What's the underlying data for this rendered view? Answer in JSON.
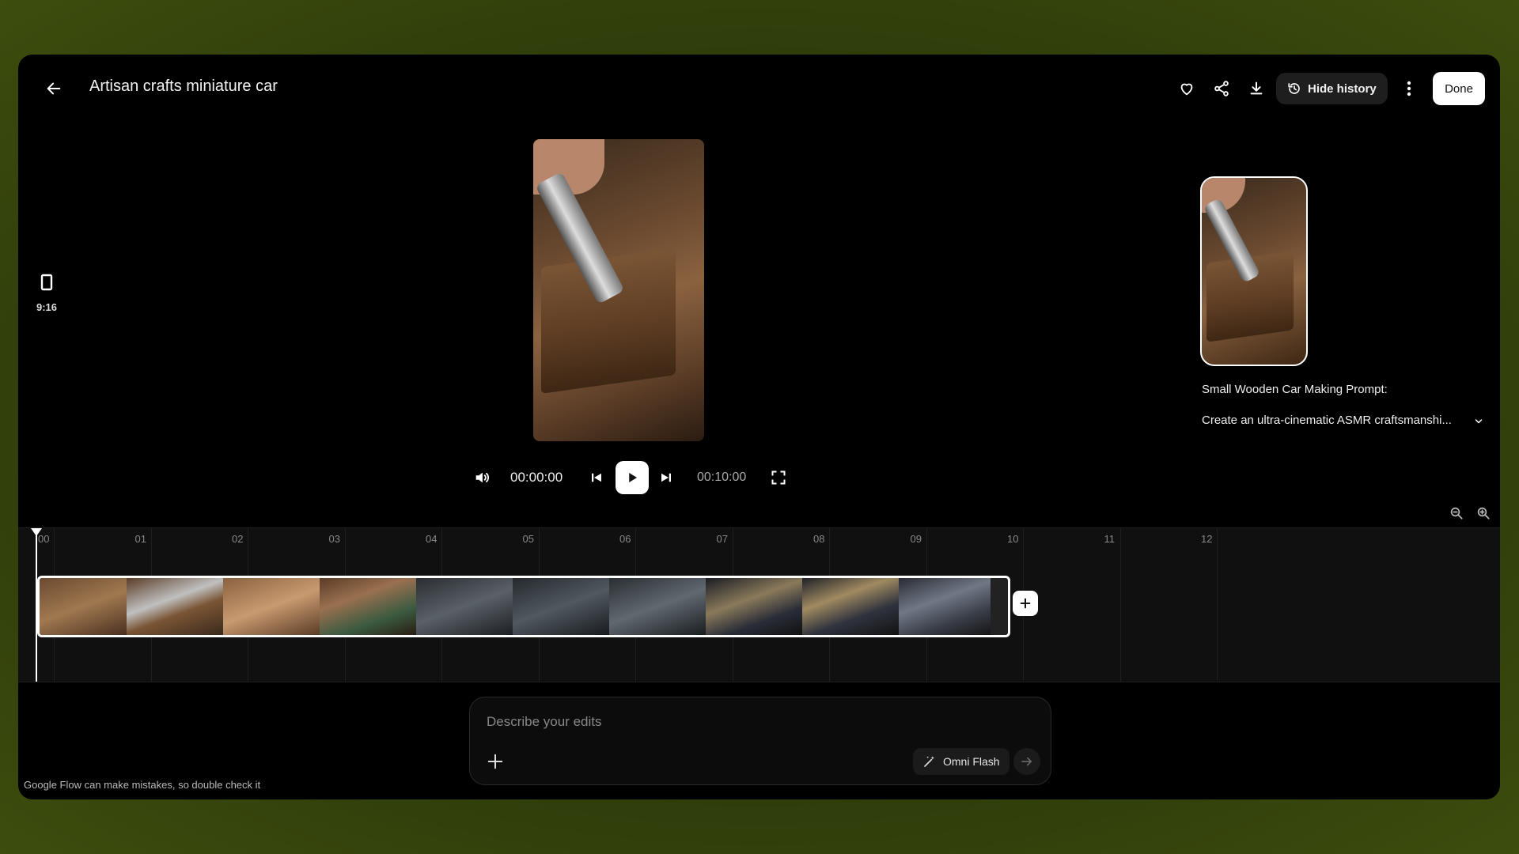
{
  "header": {
    "title": "Artisan crafts miniature car",
    "hide_history_label": "Hide history",
    "done_label": "Done"
  },
  "aspect": {
    "label": "9:16"
  },
  "history": {
    "prompt_title": "Small Wooden Car Making Prompt:",
    "prompt_text": "Create an ultra-cinematic ASMR craftsmanshi..."
  },
  "player": {
    "current_time": "00:00:00",
    "total_time": "00:10:00"
  },
  "timeline": {
    "ticks": [
      "00",
      "01",
      "02",
      "03",
      "04",
      "05",
      "06",
      "07",
      "08",
      "09",
      "10",
      "11",
      "12"
    ]
  },
  "editor": {
    "placeholder": "Describe your edits",
    "model_label": "Omni Flash"
  },
  "footer": {
    "disclaimer": "Google Flow can make mistakes, so double check it"
  },
  "colors": {
    "accent": "#ffffff",
    "background": "#000000"
  }
}
